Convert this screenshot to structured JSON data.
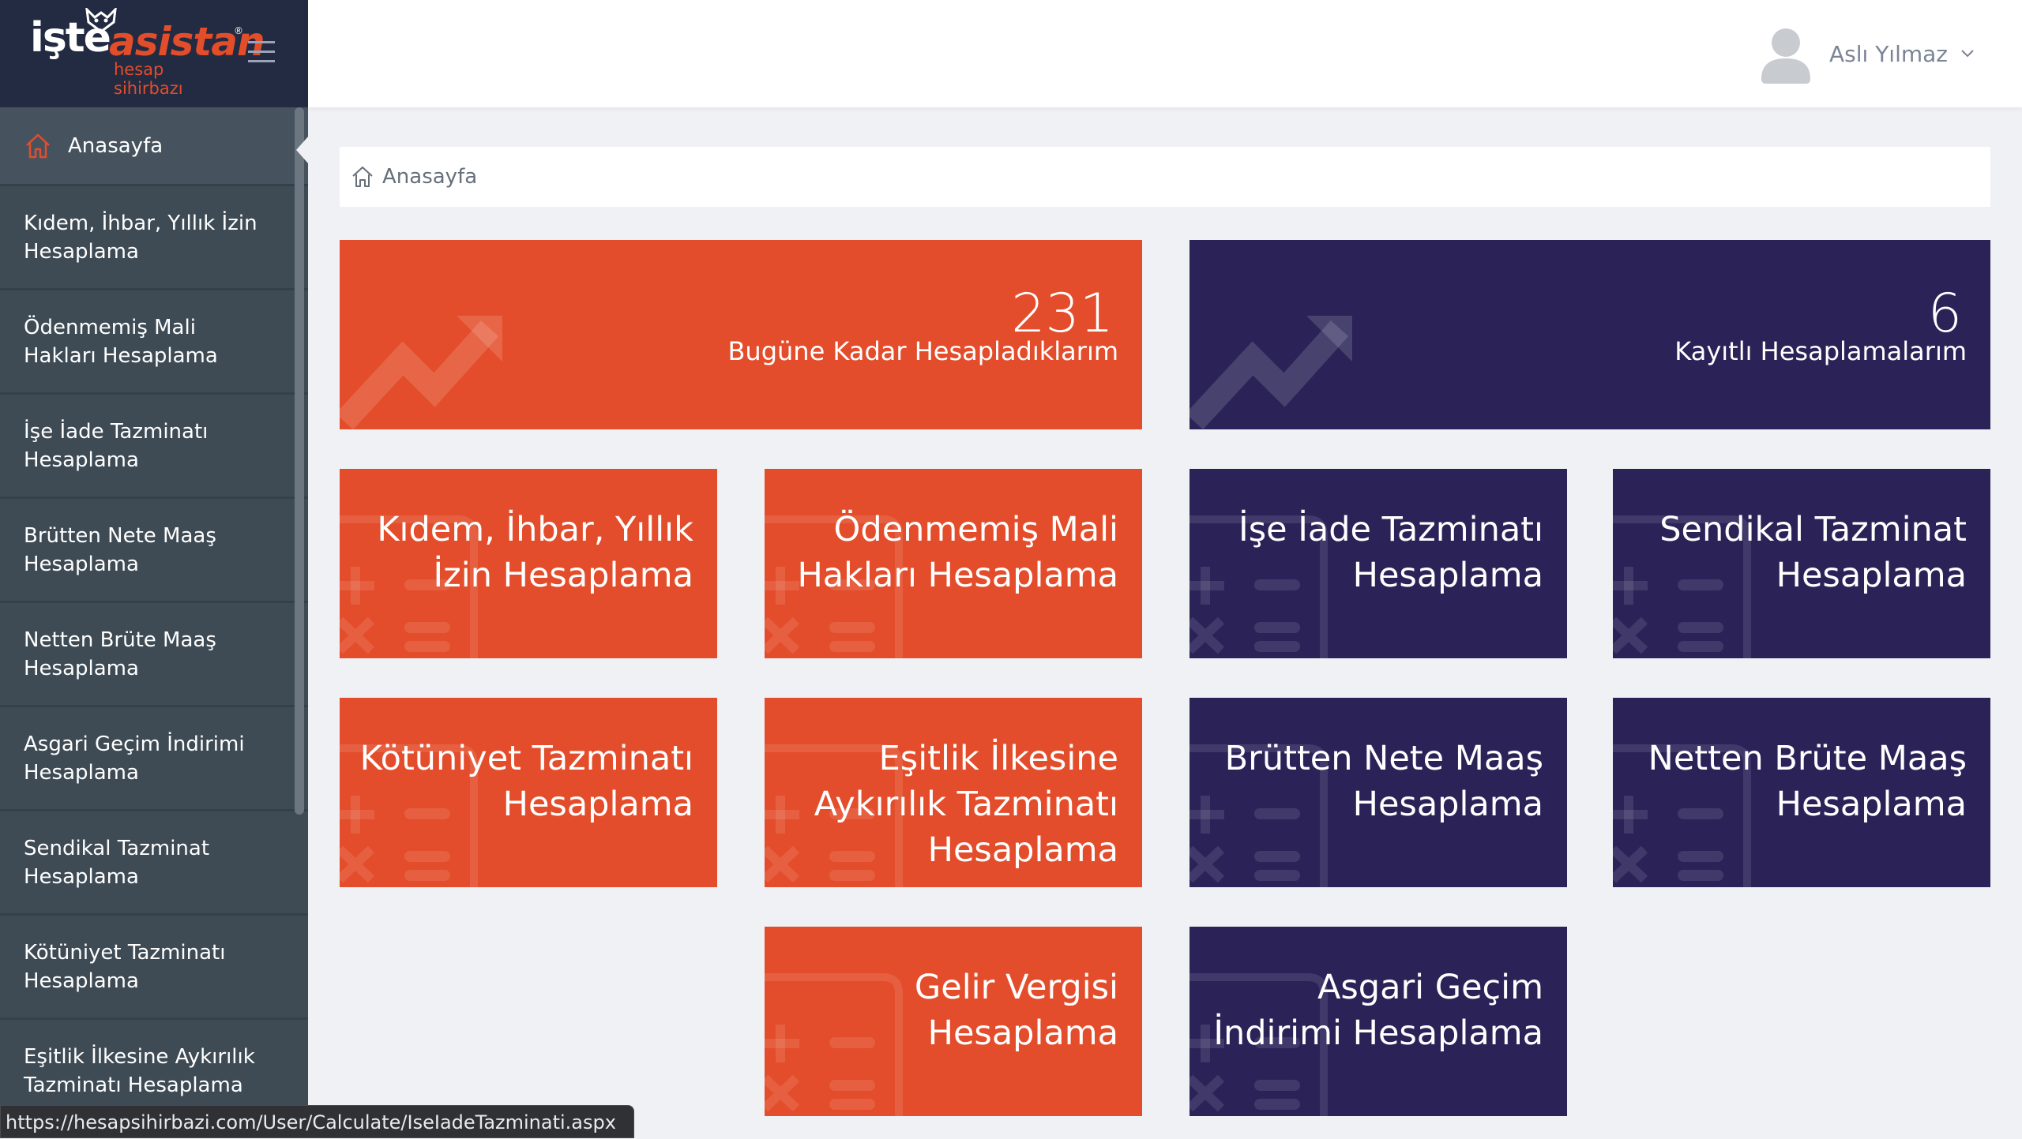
{
  "brand": {
    "name_part1": "işte",
    "name_part2": "asistan",
    "registered": "®",
    "tagline": "hesap sihirbazı",
    "accent_color": "#e34d2b",
    "navy_color": "#2b2358"
  },
  "sidebar": {
    "items": [
      {
        "label": "Anasayfa",
        "icon": "home-icon",
        "active": true
      },
      {
        "label": "Kıdem, İhbar, Yıllık İzin Hesaplama"
      },
      {
        "label": "Ödenmemiş Mali Hakları Hesaplama"
      },
      {
        "label": "İşe İade Tazminatı Hesaplama"
      },
      {
        "label": "Brütten Nete Maaş Hesaplama"
      },
      {
        "label": "Netten Brüte Maaş Hesaplama"
      },
      {
        "label": "Asgari Geçim İndirimi Hesaplama"
      },
      {
        "label": "Sendikal Tazminat Hesaplama"
      },
      {
        "label": "Kötüniyet Tazminatı Hesaplama"
      },
      {
        "label": "Eşitlik İlkesine Aykırılık Tazminatı Hesaplama"
      }
    ]
  },
  "header": {
    "user_name": "Aslı Yılmaz"
  },
  "breadcrumb": {
    "label": "Anasayfa"
  },
  "stats": [
    {
      "value": "231",
      "label": "Bugüne Kadar Hesapladıklarım",
      "color": "orange"
    },
    {
      "value": "6",
      "label": "Kayıtlı Hesaplamalarım",
      "color": "navy"
    }
  ],
  "tiles": [
    {
      "label": "Kıdem, İhbar, Yıllık İzin Hesaplama",
      "color": "orange"
    },
    {
      "label": "Ödenmemiş Mali Hakları Hesaplama",
      "color": "orange"
    },
    {
      "label": "İşe İade Tazminatı Hesaplama",
      "color": "navy"
    },
    {
      "label": "Sendikal Tazminat Hesaplama",
      "color": "navy"
    },
    {
      "label": "Kötüniyet Tazminatı Hesaplama",
      "color": "orange"
    },
    {
      "label": "Eşitlik İlkesine Aykırılık Tazminatı Hesaplama",
      "color": "orange"
    },
    {
      "label": "Brütten Nete Maaş Hesaplama",
      "color": "navy"
    },
    {
      "label": "Netten Brüte Maaş Hesaplama",
      "color": "navy"
    },
    {
      "label": "Gelir Vergisi Hesaplama",
      "color": "orange"
    },
    {
      "label": "Asgari Geçim İndirimi Hesaplama",
      "color": "navy"
    }
  ],
  "status_bar": {
    "url": "https://hesapsihirbazi.com/User/Calculate/IseIadeTazminati.aspx"
  }
}
